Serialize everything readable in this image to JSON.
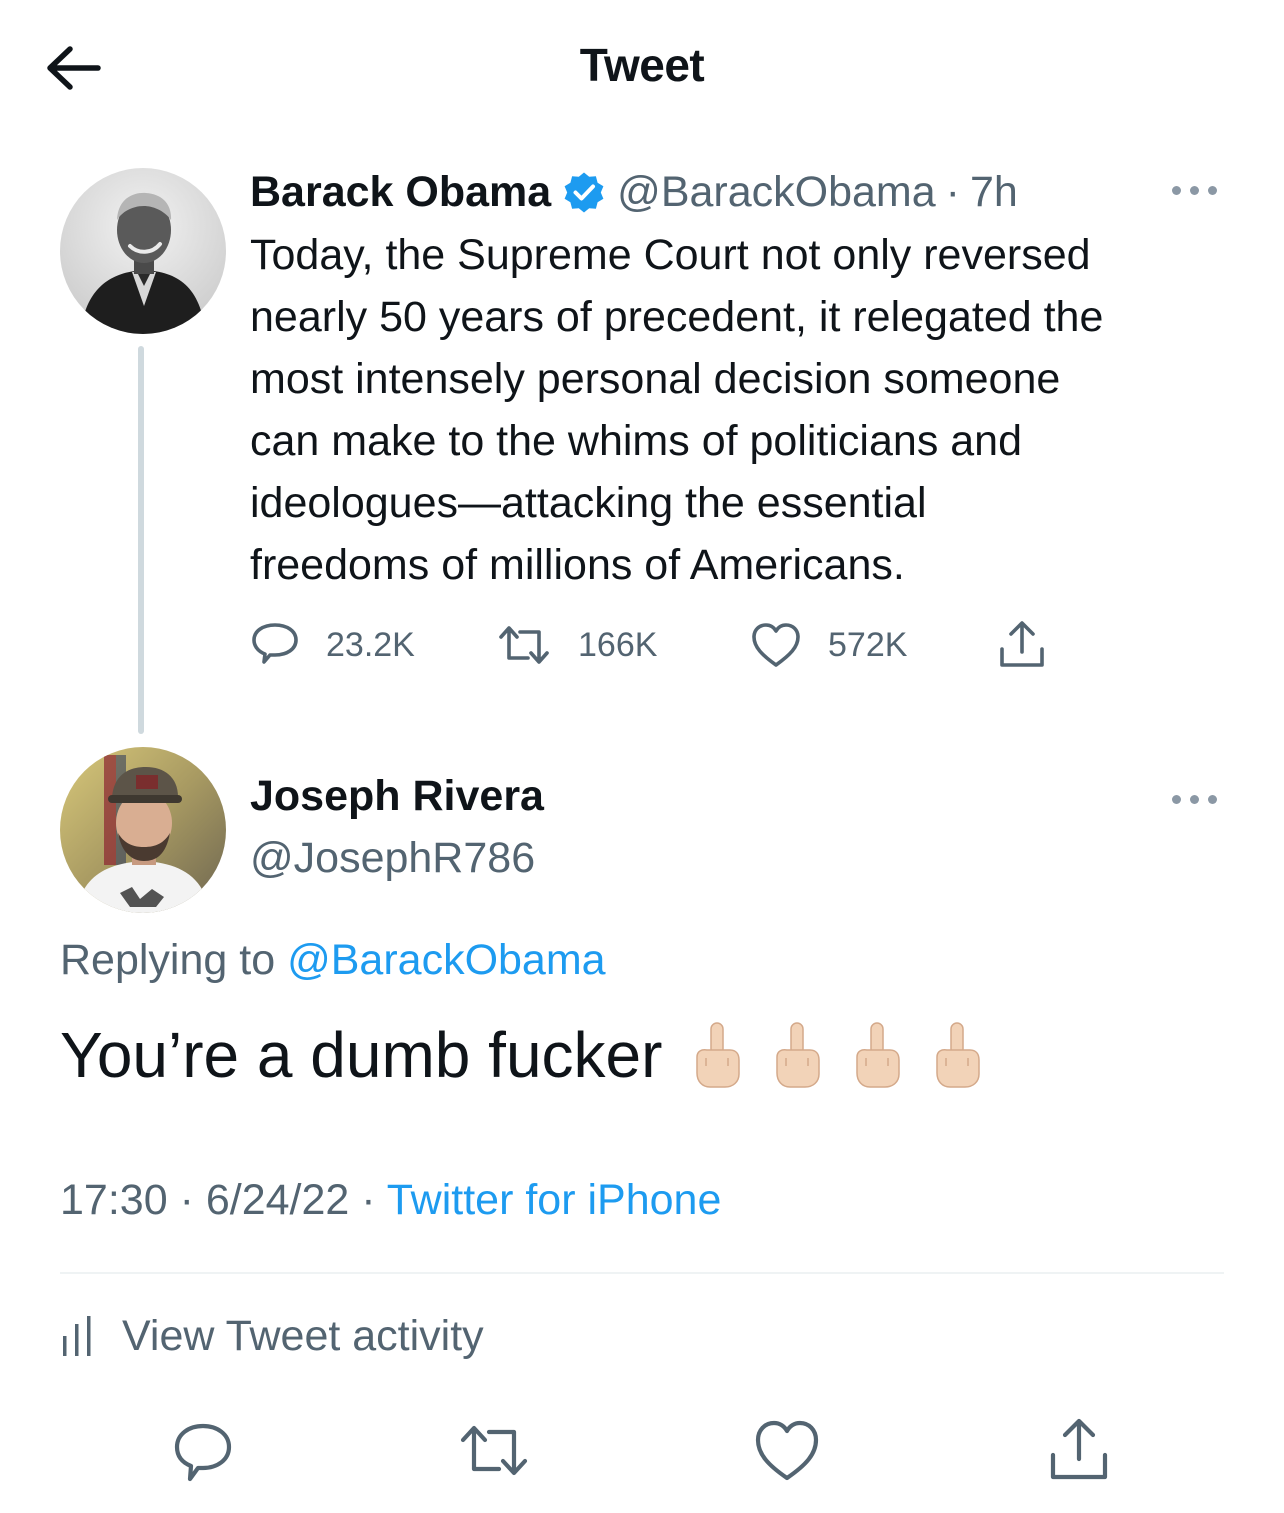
{
  "header": {
    "title": "Tweet"
  },
  "icons": {
    "back": "arrow-left-icon",
    "verified": "verified-badge-icon",
    "more": "more-horizontal-icon",
    "reply": "reply-icon",
    "retweet": "retweet-icon",
    "like": "heart-icon",
    "share": "share-icon",
    "activity": "bar-chart-icon",
    "emoji": "middle-finger-emoji"
  },
  "colors": {
    "accent": "#1d9bf0",
    "secondary_text": "#536471",
    "primary_text": "#0f1419",
    "divider": "#eff3f4"
  },
  "parent_tweet": {
    "author_name": "Barack Obama",
    "author_handle": "@BarackObama",
    "separator": "·",
    "time": "7h",
    "text_lines": [
      "Today, the Supreme Court not only reversed",
      "nearly 50 years of precedent, it relegated the",
      "most intensely personal decision someone",
      "can make to the whims of politicians and",
      "ideologues—attacking the essential",
      "freedoms of millions of Americans."
    ],
    "replies": "23.2K",
    "retweets": "166K",
    "likes": "572K"
  },
  "reply_tweet": {
    "author_name": "Joseph Rivera",
    "author_handle": "@JosephR786",
    "replying_prefix": "Replying to",
    "replying_to": "@BarackObama",
    "text": "You’re a dumb fucker",
    "emoji_count": 4,
    "time": "17:30",
    "date": "6/24/22",
    "separator": "·",
    "source": "Twitter for iPhone"
  },
  "activity": {
    "label": "View Tweet activity"
  }
}
